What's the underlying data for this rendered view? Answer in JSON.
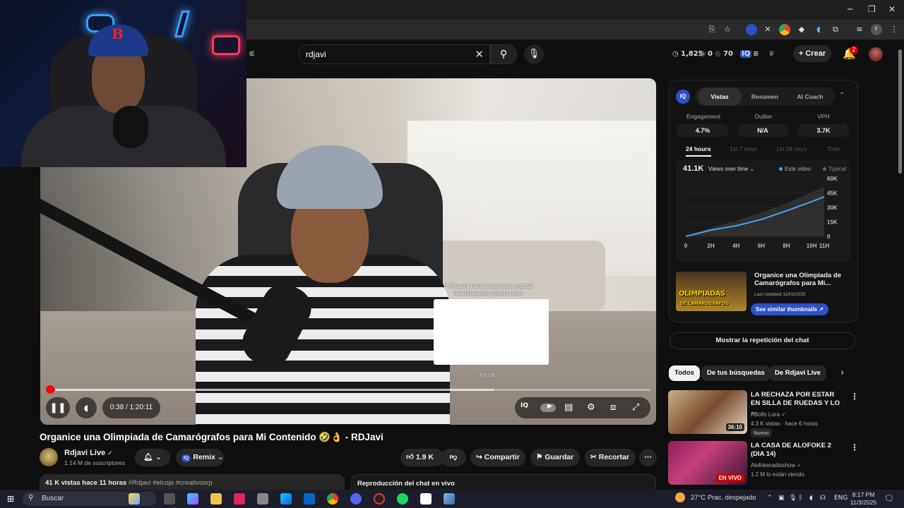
{
  "browser": {
    "window_controls": {
      "minimize": "─",
      "maximize": "❐",
      "close": "✕"
    }
  },
  "header": {
    "search_value": "rdjavi",
    "stats": {
      "views": "1,825",
      "zero": "0",
      "seventy": "70"
    },
    "create_label": "Crear",
    "notif_count": "2"
  },
  "player": {
    "tooltip": "⇧ Arrastra hacia arriba para realizar una búsqueda más precisa",
    "preview_time": "59:05",
    "time": "0:38 / 1:20:11",
    "progress_fraction": 0.008,
    "buffer_fraction": 0.74
  },
  "video": {
    "title": "Organice una Olimpiada de Camarógrafos para Mi Contenido 🤣👌 - RDJavi",
    "channel": "Rdjavi Live",
    "verified": "✓",
    "subscribers": "1.14 M de suscriptores",
    "remix_label": "Remix",
    "likes": "1.9 K",
    "share_label": "Compartir",
    "save_label": "Guardar",
    "clip_label": "Recortar",
    "views_time": "41 K vistas  hace 11 horas",
    "tags": "#Rdjavi #elcojo #creativosrp",
    "chat_replay_label": "Reproducción del chat en vivo"
  },
  "panel": {
    "logo": "IQ",
    "tabs": [
      "Vistas",
      "Resumen",
      "AI Coach"
    ],
    "metrics": [
      {
        "label": "Engagement",
        "value": "4.7%"
      },
      {
        "label": "Outlier",
        "value": "N/A"
      },
      {
        "label": "VPH",
        "value": "3.7K"
      }
    ],
    "ranges": [
      "24 hours",
      "1st 7 days",
      "1st 28 days",
      "Todo"
    ],
    "chart_total": "41.1K",
    "chart_dropdown": "Views over time ⌄",
    "legend": [
      "Este video",
      "Typical"
    ],
    "thumb_text": "OLIMPIADAS",
    "thumb_subtext": "DE CAMARÓGRAFOS",
    "thumb_title": "Organice una Olimpiada de Camarógrafos para Mi...",
    "last_updated": "Last Updated 11/03/2025",
    "similar_btn": "See similar thumbnails ↗",
    "show_chat": "Mostrar la repetición del chat"
  },
  "chart_data": {
    "type": "line",
    "x": [
      "0",
      "2H",
      "4H",
      "6H",
      "8H",
      "10H",
      "11H"
    ],
    "x_hours": [
      0,
      2,
      4,
      6,
      8,
      10,
      11
    ],
    "series": [
      {
        "name": "Este video",
        "color": "#4aa3f0",
        "values": [
          0,
          6500,
          11000,
          17500,
          26500,
          36000,
          41100
        ]
      },
      {
        "name": "Typical",
        "color": "#555555",
        "values": [
          0,
          9000,
          16000,
          25000,
          34000,
          46000,
          51000
        ]
      }
    ],
    "yticks": [
      "0",
      "15K",
      "30K",
      "45K",
      "60K"
    ],
    "ytick_values": [
      0,
      15000,
      30000,
      45000,
      60000
    ],
    "ylim": [
      0,
      60000
    ],
    "xlim": [
      0,
      11
    ]
  },
  "chips": [
    "Todos",
    "De tus búsquedas",
    "De Rdjavi Live"
  ],
  "recommended": [
    {
      "title": "LA RECHAZA POR ESTAR EN SILLA DE RUEDAS Y LO ...",
      "channel": "Adolfo Lora ✓",
      "meta": "4.3 K vistas · hace 6 horas",
      "badge": "Nuevo",
      "duration": "36:10"
    },
    {
      "title": "LA CASA DE ALOFOKE 2 (DIA 14)",
      "channel": "Alofokeradioshow ✓",
      "meta": "1.2 M lo están viendo",
      "live": "EN VIVO"
    }
  ],
  "taskbar": {
    "search_placeholder": "Buscar",
    "weather": "27°C  Prac. despejado",
    "lang": "ENG",
    "time": "8:17 PM",
    "date": "11/3/2025"
  }
}
